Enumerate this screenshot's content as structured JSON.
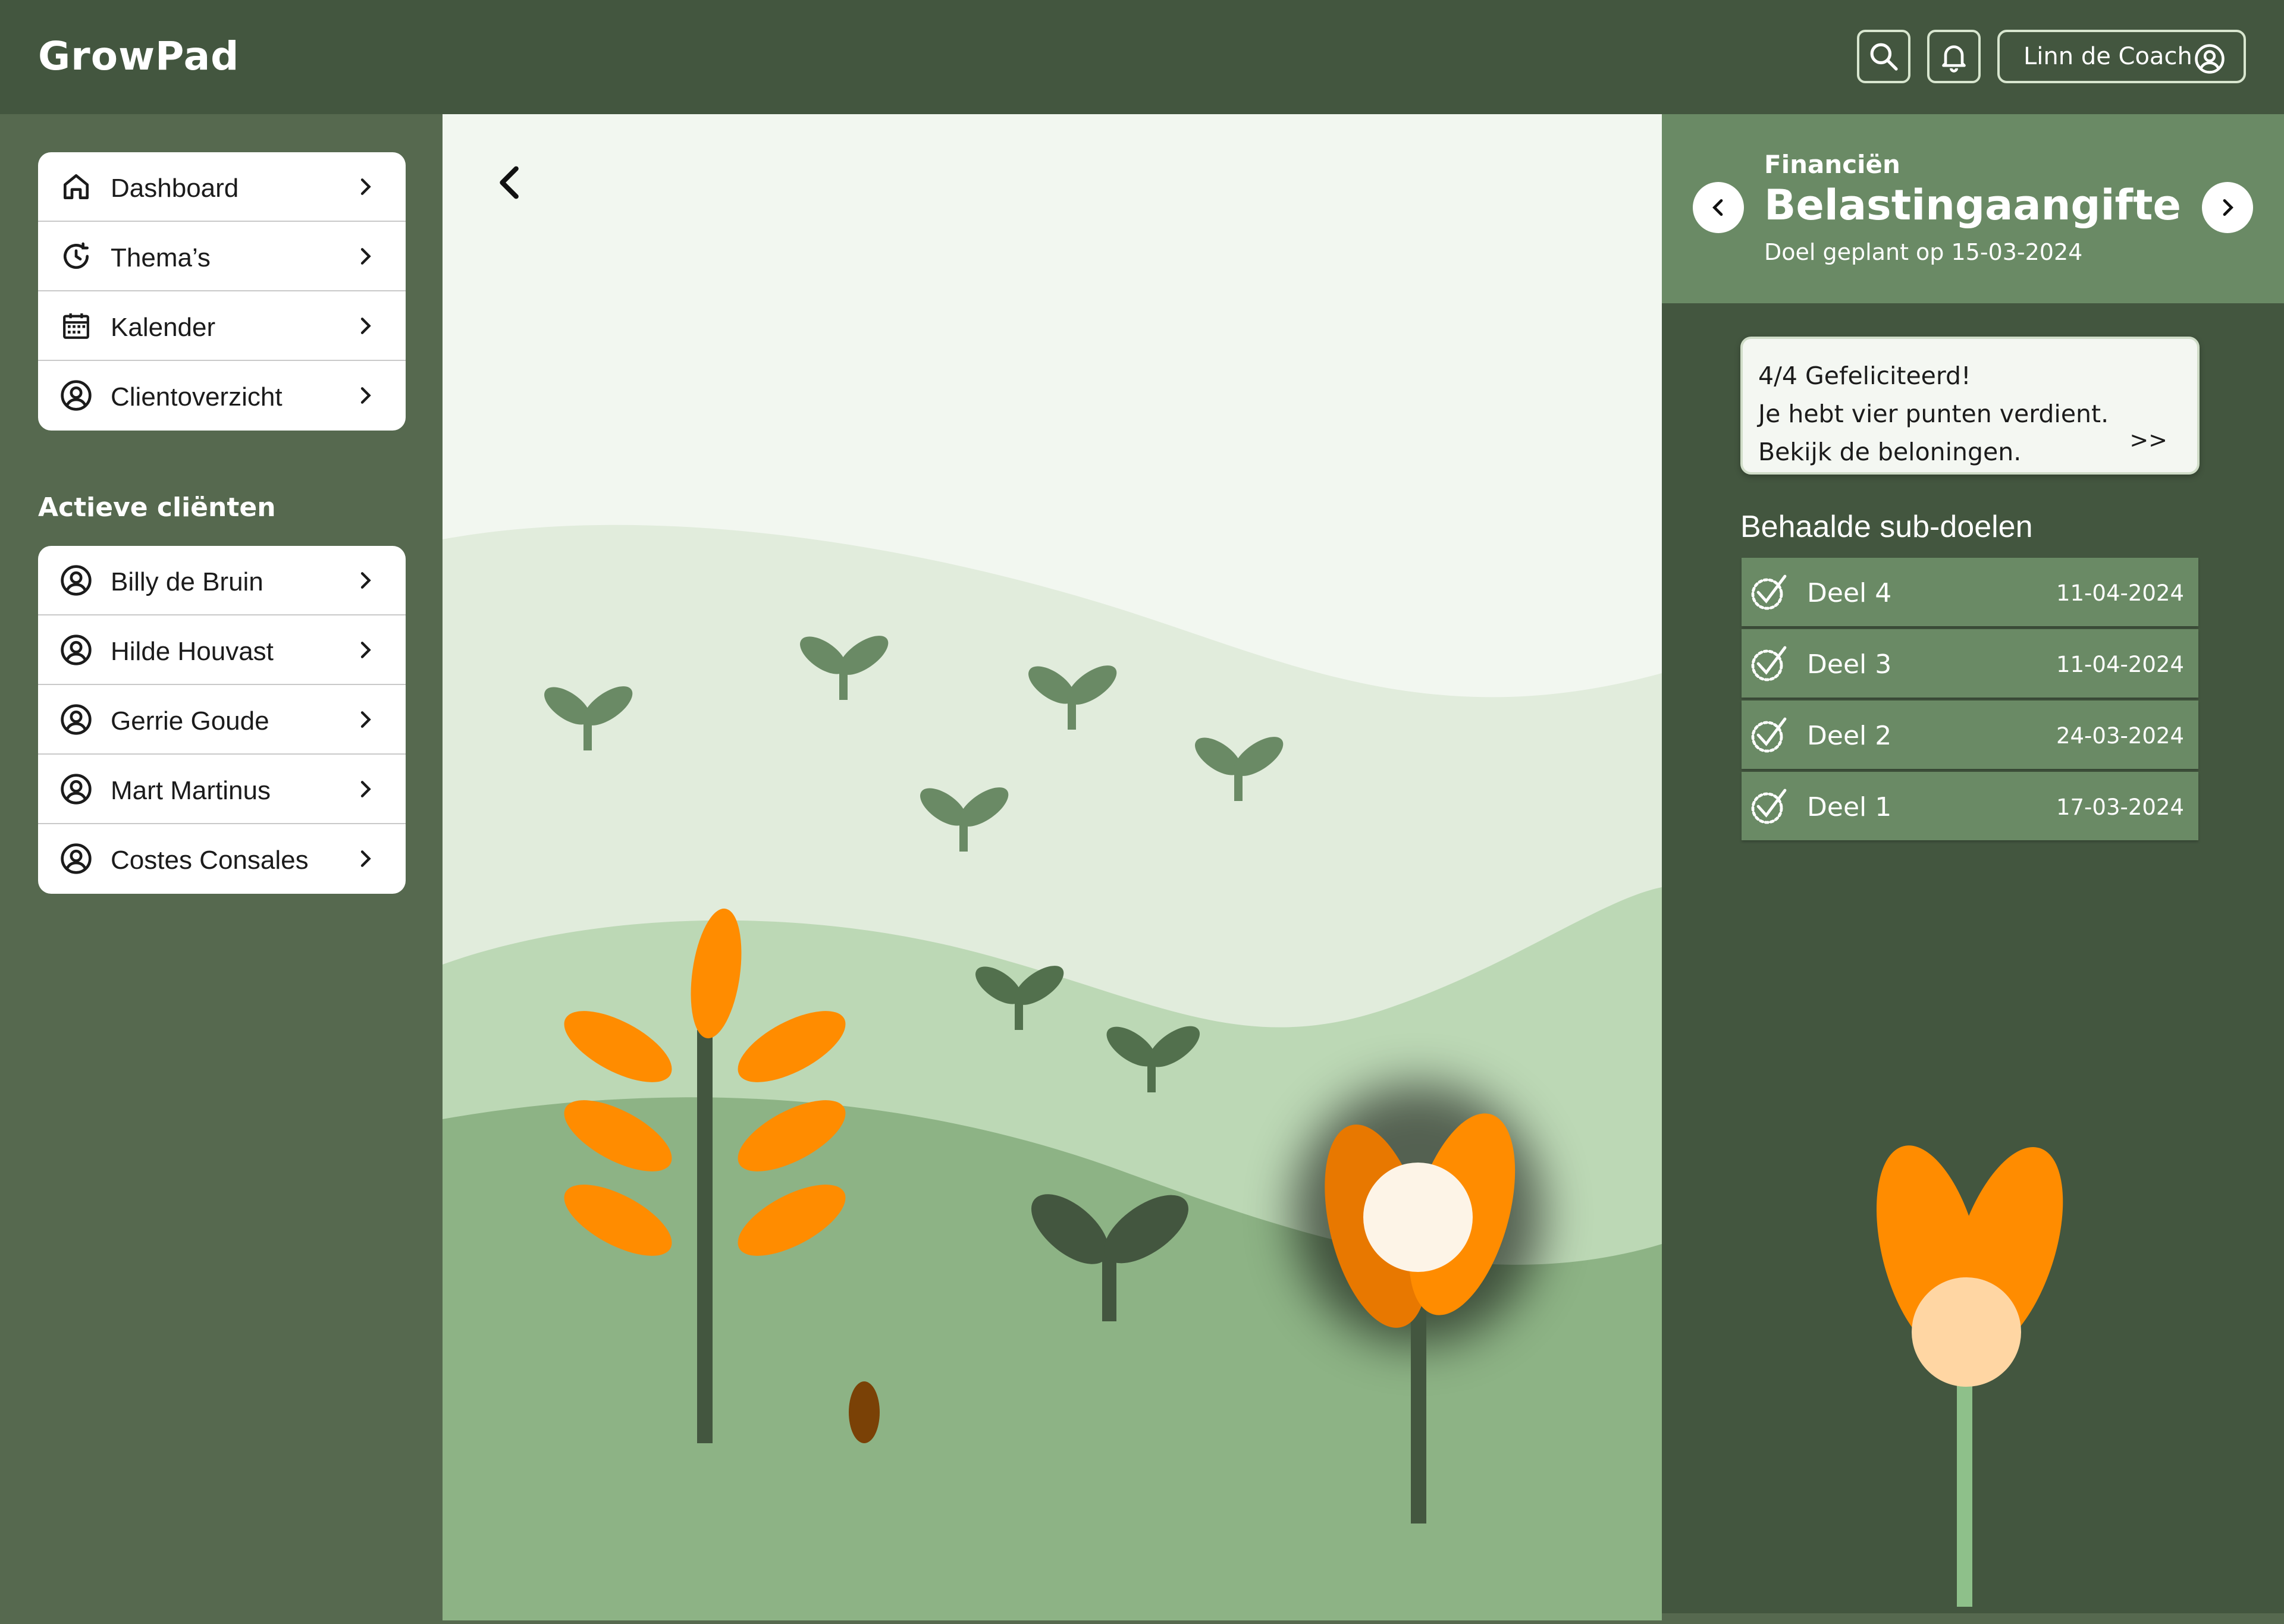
{
  "app": {
    "name": "GrowPad"
  },
  "header": {
    "user_label": "Linn de Coach",
    "search_icon": "search-icon",
    "notifications_icon": "bell-icon",
    "user_icon": "user-circle-icon"
  },
  "sidebar": {
    "menu": [
      {
        "label": "Dashboard",
        "icon": "home-icon"
      },
      {
        "label": "Thema’s",
        "icon": "clock-refresh-icon"
      },
      {
        "label": "Kalender",
        "icon": "calendar-icon"
      },
      {
        "label": "Clientoverzicht",
        "icon": "user-circle-icon"
      }
    ],
    "clients_title": "Actieve cliënten",
    "clients": [
      {
        "label": "Billy de Bruin"
      },
      {
        "label": "Hilde Houvast"
      },
      {
        "label": "Gerrie Goude"
      },
      {
        "label": "Mart Martinus"
      },
      {
        "label": "Costes Consales"
      }
    ]
  },
  "goal": {
    "category": "Financiën",
    "title": "Belastingaangifte",
    "planned": "Doel geplant op 15-03-2024"
  },
  "reward": {
    "line1": "4/4 Gefeliciteerd!",
    "line2": "Je hebt vier punten verdient.",
    "line3": "Bekijk de beloningen.",
    "more": ">>"
  },
  "subgoals": {
    "title": "Behaalde sub-doelen",
    "items": [
      {
        "name": "Deel 4",
        "date": "11-04-2024"
      },
      {
        "name": "Deel 3",
        "date": "11-04-2024"
      },
      {
        "name": "Deel 2",
        "date": "24-03-2024"
      },
      {
        "name": "Deel 1",
        "date": "17-03-2024"
      }
    ]
  },
  "colors": {
    "header": "#43563f",
    "sidebar": "#56694f",
    "accent_orange": "#ff8c00",
    "panel_green": "#6a8a65"
  }
}
